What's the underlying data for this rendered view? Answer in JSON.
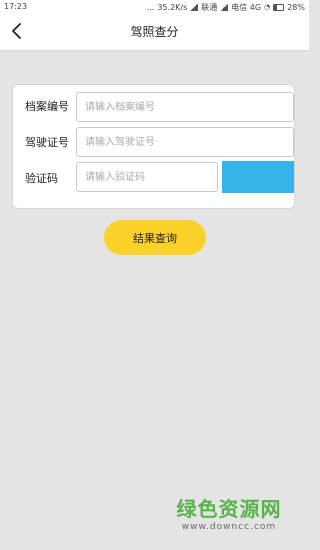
{
  "status_bar": {
    "time": "17:23",
    "dots": "...",
    "speed": "35.2K/s",
    "carrier1": "联通",
    "carrier2": "电信 4G",
    "battery": "28%"
  },
  "nav": {
    "title": "驾照查分"
  },
  "form": {
    "fields": [
      {
        "label": "档案编号",
        "placeholder": "请输入档案编号"
      },
      {
        "label": "驾驶证号",
        "placeholder": "请输入驾驶证号"
      },
      {
        "label": "验证码",
        "placeholder": "请输入验证码"
      }
    ],
    "captcha_color": "#35b5ea"
  },
  "query_button": {
    "label": "结果查询",
    "color": "#fcd12a"
  },
  "watermark": {
    "title": "绿色资源网",
    "url": "www.downcc.com"
  },
  "icons": {
    "back": "chevron-left-icon",
    "signal": "signal-icon",
    "wifi": "wifi-icon",
    "battery": "battery-icon"
  }
}
